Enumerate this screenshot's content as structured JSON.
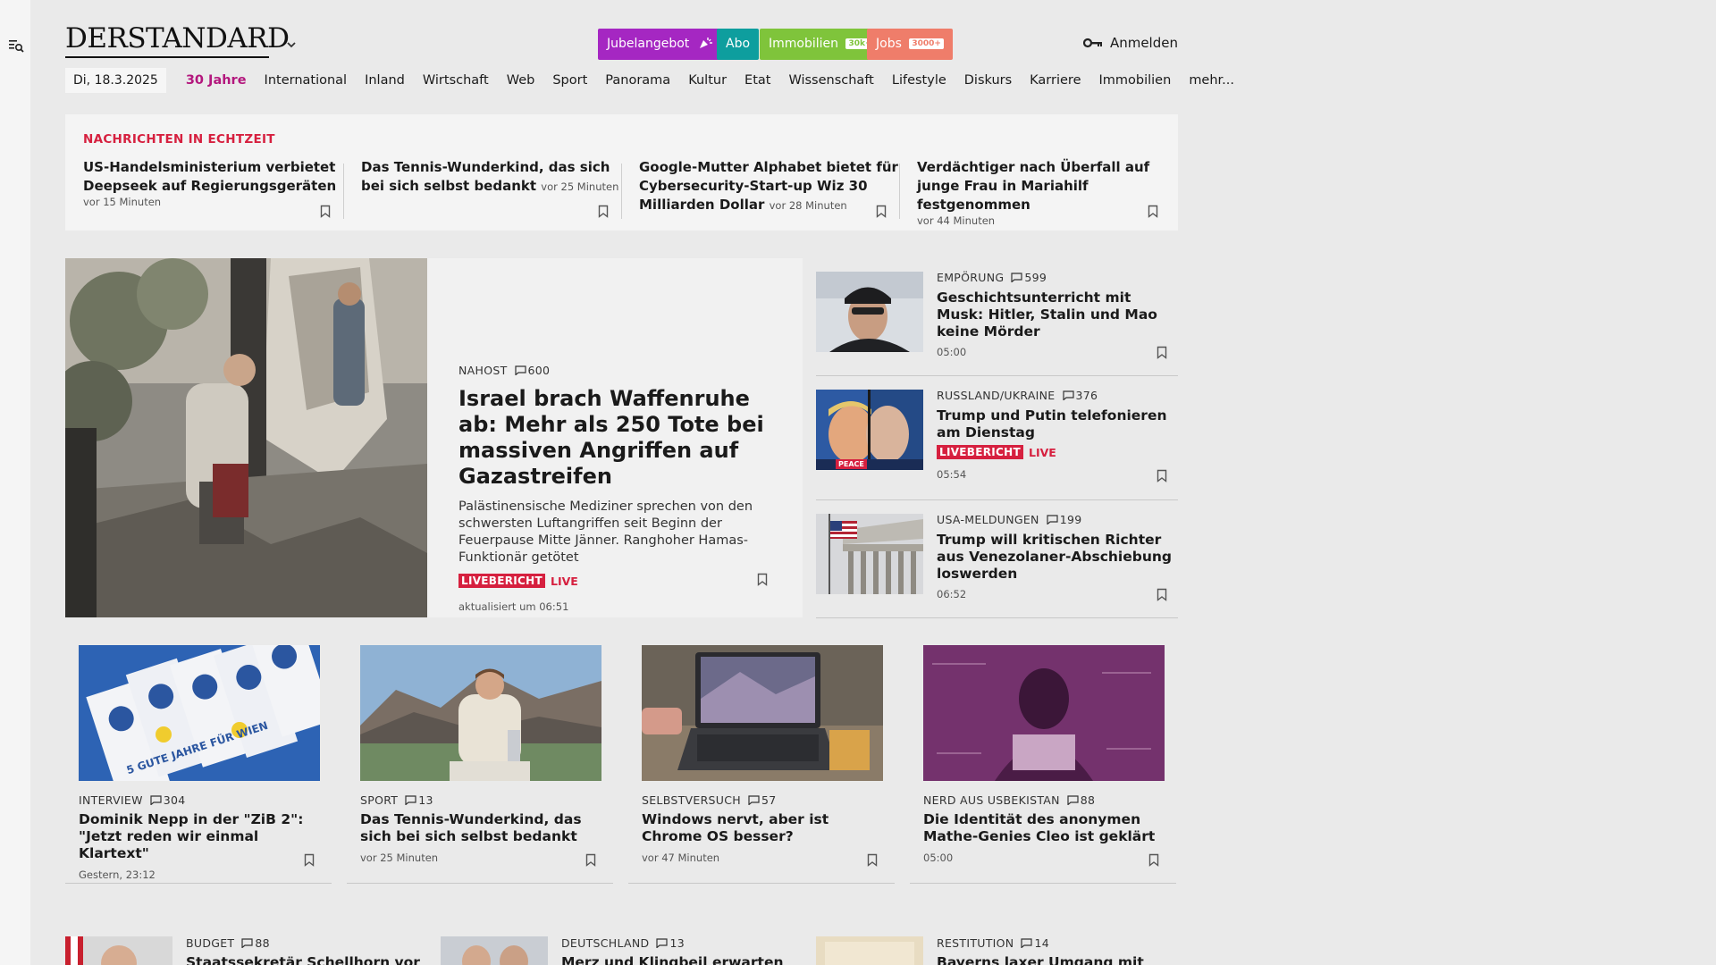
{
  "header": {
    "logo": "DERSTANDARD",
    "promos": [
      {
        "label": "Jubelangebot",
        "color": "#a527c2"
      },
      {
        "label": "Abo",
        "color": "#0e9e9e"
      },
      {
        "label": "Immobilien",
        "badge": "30k+",
        "color": "#7fc43b"
      },
      {
        "label": "Jobs",
        "badge": "3000+",
        "color": "#ef7d6a"
      }
    ],
    "login_label": "Anmelden"
  },
  "nav": {
    "date": "Di, 18.3.2025",
    "items": [
      "30 Jahre",
      "International",
      "Inland",
      "Wirtschaft",
      "Web",
      "Sport",
      "Panorama",
      "Kultur",
      "Etat",
      "Wissenschaft",
      "Lifestyle",
      "Diskurs",
      "Karriere",
      "Immobilien",
      "mehr..."
    ]
  },
  "realtime": {
    "label": "NACHRICHTEN IN ECHTZEIT",
    "items": [
      {
        "title": "US-Handelsministerium verbietet Deepseek auf Regierungsgeräten",
        "time": "vor 15 Minuten"
      },
      {
        "title": "Das Tennis-Wunderkind, das sich bei sich selbst bedankt",
        "time": "vor 25 Minuten"
      },
      {
        "title": "Google-Mutter Alphabet bietet für Cybersecurity-Start-up Wiz 30 Milliarden Dollar",
        "time": "vor 28 Minuten"
      },
      {
        "title": "Verdächtiger nach Überfall auf junge Frau in Mariahilf festgenommen",
        "time": "vor 44 Minuten"
      }
    ]
  },
  "lead": {
    "kicker": "NAHOST",
    "comments": "600",
    "title": "Israel brach Waffenruhe ab: Mehr als 250 Tote bei massiven Angriffen auf Gazastreifen",
    "subtitle": "Palästinensische Mediziner sprechen von den schwersten Luftangriffen seit Beginn der Feuerpause Mitte Jänner. Ranghoher Hamas-Funktionär getötet",
    "live_badge": "LIVEBERICHT",
    "live_text": "LIVE",
    "meta": "aktualisiert um 06:51"
  },
  "side": [
    {
      "kicker": "EMPÖRUNG",
      "comments": "599",
      "title": "Geschichtsunterricht mit Musk: Hitler, Stalin und Mao keine Mörder",
      "meta": "05:00"
    },
    {
      "kicker": "RUSSLAND/UKRAINE",
      "comments": "376",
      "title": "Trump und Putin telefonieren am Dienstag",
      "live_badge": "LIVEBERICHT",
      "live_text": "LIVE",
      "meta": "05:54",
      "image_label": "PEACE"
    },
    {
      "kicker": "USA-MELDUNGEN",
      "comments": "199",
      "title": "Trump will kritischen Richter aus Venezolaner-Abschiebung loswerden",
      "meta": "06:52"
    }
  ],
  "cards": [
    {
      "kicker": "INTERVIEW",
      "comments": "304",
      "title": "Dominik Nepp in der \"ZiB 2\": \"Jetzt reden wir einmal Klartext\"",
      "meta": "Gestern, 23:12",
      "image_text": "5 GUTE JAHRE FÜR WIEN"
    },
    {
      "kicker": "SPORT",
      "comments": "13",
      "title": "Das Tennis-Wunderkind, das sich bei sich selbst bedankt",
      "meta": "vor 25 Minuten"
    },
    {
      "kicker": "SELBSTVERSUCH",
      "comments": "57",
      "title": "Windows nervt, aber ist Chrome OS besser?",
      "meta": "vor 47 Minuten"
    },
    {
      "kicker": "NERD AUS USBEKISTAN",
      "comments": "88",
      "title": "Die Identität des anonymen Mathe-Genies Cleo ist geklärt",
      "meta": "05:00"
    }
  ],
  "bottom": [
    {
      "kicker": "BUDGET",
      "comments": "88",
      "title": "Staatssekretär Schellhorn vor"
    },
    {
      "kicker": "DEUTSCHLAND",
      "comments": "13",
      "title": "Merz und Klingbeil erwarten"
    },
    {
      "kicker": "RESTITUTION",
      "comments": "14",
      "title": "Bayerns laxer Umgang mit NS-"
    }
  ],
  "colors": {
    "accent_magenta": "#b3177d",
    "live_red": "#d6203f",
    "background": "#eaeaea",
    "panel": "#f4f4f4"
  }
}
